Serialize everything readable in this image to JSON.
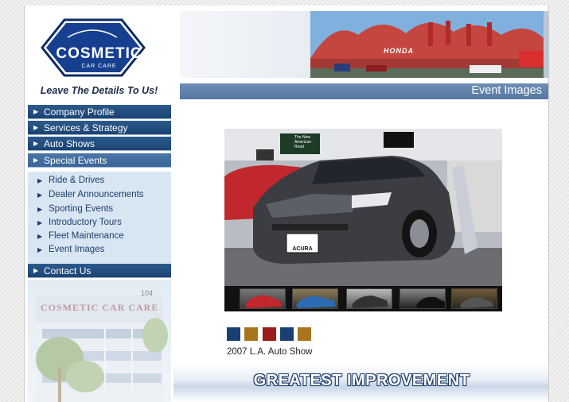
{
  "logo": {
    "title": "COSMETIC",
    "subtitle": "CAR CARE"
  },
  "tagline": "Leave The Details To Us!",
  "nav": {
    "main": [
      {
        "label": "Company Profile"
      },
      {
        "label": "Services & Strategy"
      },
      {
        "label": "Auto Shows"
      },
      {
        "label": "Special Events"
      }
    ],
    "sub": [
      {
        "label": "Ride & Drives"
      },
      {
        "label": "Dealer Announcements"
      },
      {
        "label": "Sporting Events"
      },
      {
        "label": "Introductory Tours"
      },
      {
        "label": "Fleet Maintenance"
      },
      {
        "label": "Event Images"
      }
    ],
    "contact": {
      "label": "Contact Us"
    }
  },
  "section": {
    "title": "Event Images"
  },
  "building_sign": "COSMETIC CAR CARE",
  "building_number": "104",
  "gallery": {
    "caption": "2007 L.A. Auto Show",
    "swatches": [
      "#1c3f73",
      "#a9751c",
      "#9b1c1c",
      "#1c3f73",
      "#a9751c"
    ],
    "license_plate": "ACURA",
    "booth_sign": "The New American Road",
    "header_flag_text": "HONDA"
  },
  "banner": {
    "text": "GREATEST IMPROVEMENT"
  },
  "colors": {
    "nav_dark": "#1b4373",
    "nav_sub_bg": "#d8e6f3",
    "section_bar": "#5f80ab"
  }
}
